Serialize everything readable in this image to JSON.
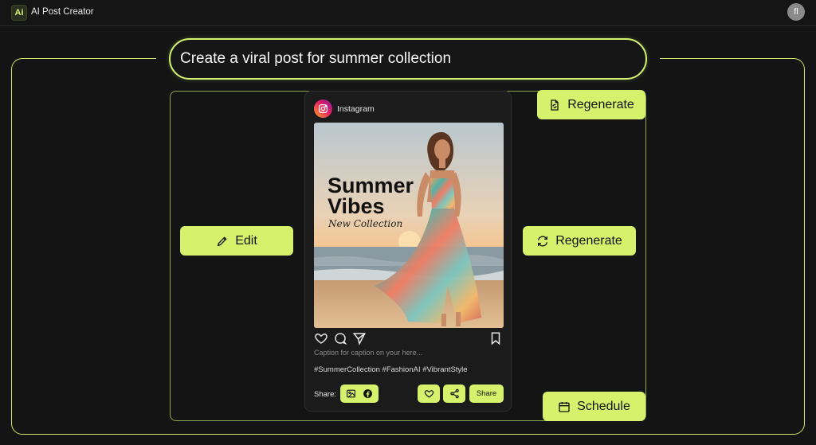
{
  "app": {
    "logo_text": "Ai",
    "title": "AI Post Creator",
    "avatar_text": "fl"
  },
  "prompt": {
    "value": "Create a viral post for summer collection"
  },
  "post": {
    "platform": "Instagram",
    "image": {
      "headline_line1": "Summer",
      "headline_line2": "Vibes",
      "subheadline": "New Collection"
    },
    "caption_placeholder": "Caption for caption on your here...",
    "hashtags": "#SummerCollection #FashionAI #VibrantStyle",
    "share_label": "Share:",
    "share_button": "Share"
  },
  "actions": {
    "edit": "Edit",
    "regenerate_top": "Regenerate",
    "regenerate_mid": "Regenerate",
    "schedule": "Schedule"
  },
  "colors": {
    "accent": "#d6f26d",
    "background": "#141414",
    "card": "#1b1b1b"
  },
  "icons": [
    "pencil-icon",
    "refresh-icon",
    "document-refresh-icon",
    "calendar-icon",
    "heart-icon",
    "comment-icon",
    "send-icon",
    "bookmark-icon",
    "image-icon",
    "facebook-icon",
    "share-icon",
    "instagram-icon"
  ]
}
